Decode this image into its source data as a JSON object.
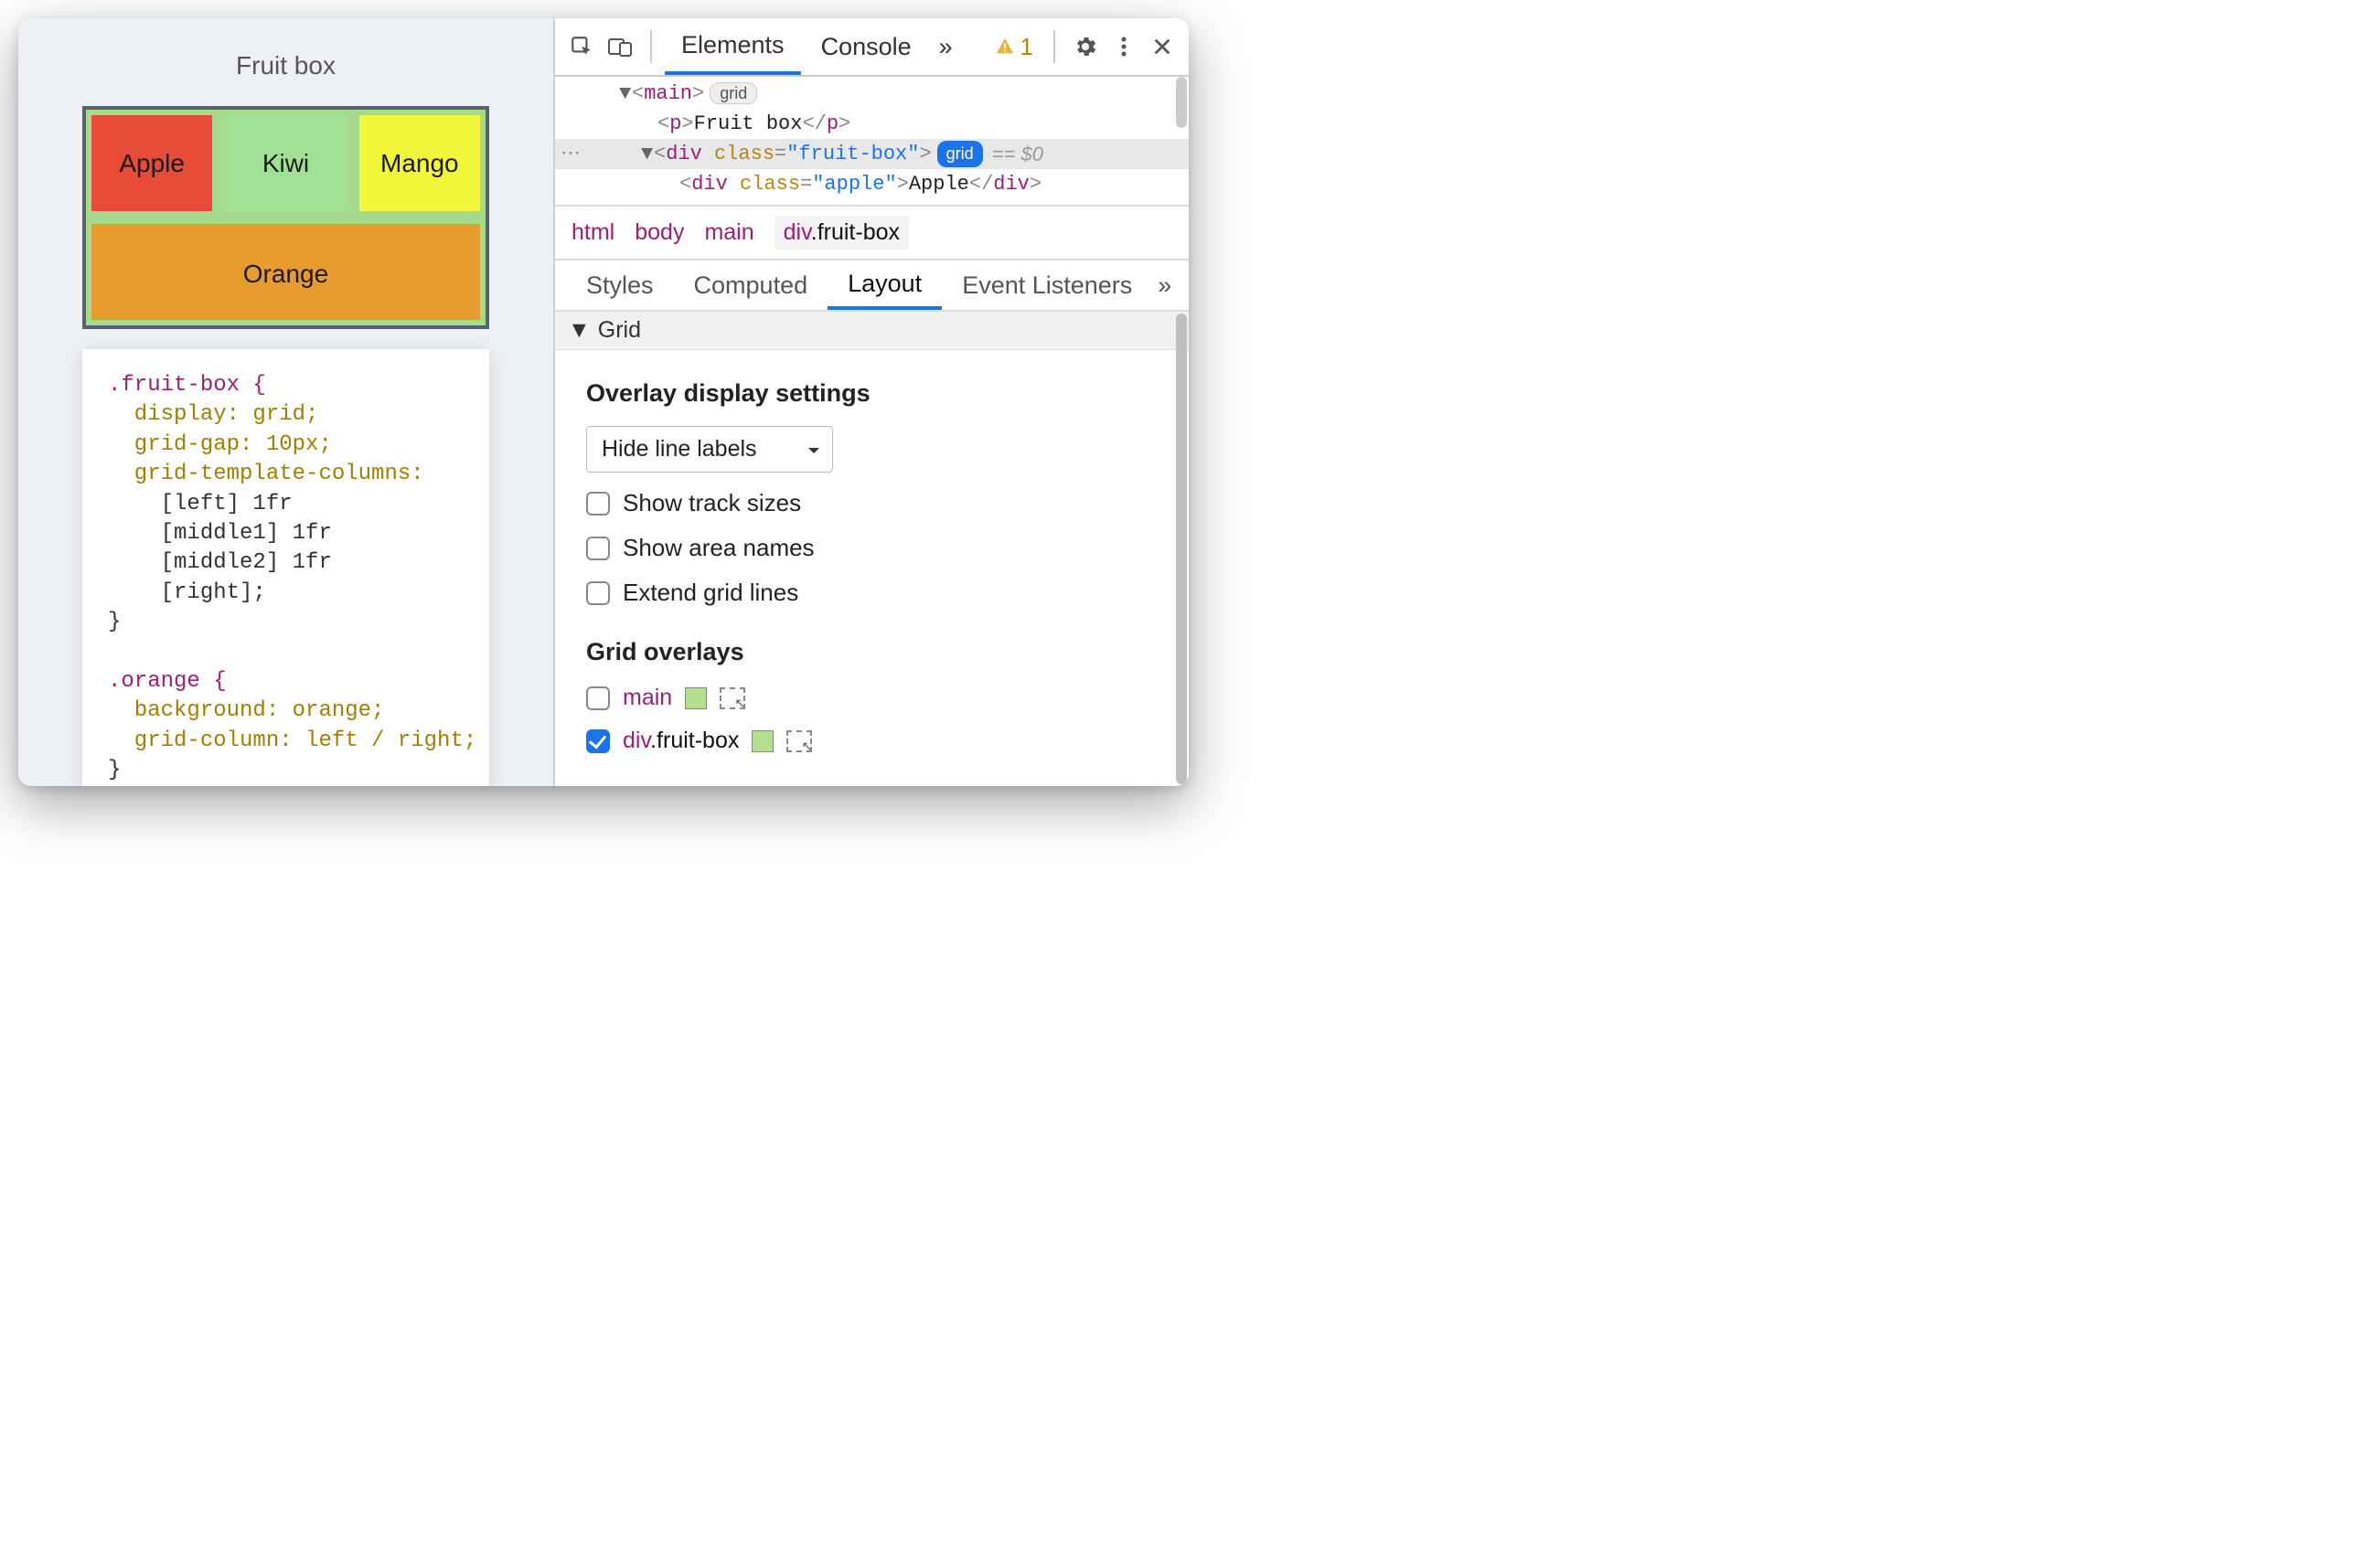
{
  "page": {
    "title": "Fruit box",
    "fruits": {
      "apple": "Apple",
      "kiwi": "Kiwi",
      "mango": "Mango",
      "orange": "Orange"
    },
    "css": {
      "r1": ".fruit-box {",
      "r2": "  display: grid;",
      "r3": "  grid-gap: 10px;",
      "r4": "  grid-template-columns:",
      "r5": "    [left] 1fr",
      "r6": "    [middle1] 1fr",
      "r7": "    [middle2] 1fr",
      "r8": "    [right];",
      "r9": "}",
      "r10": "",
      "r11": ".orange {",
      "r12": "  background: orange;",
      "r13": "  grid-column: left / right;",
      "r14": "}"
    }
  },
  "devtools": {
    "main_tabs": {
      "elements": "Elements",
      "console": "Console",
      "more": "»"
    },
    "warning_count": "1",
    "dom": {
      "main_open": "<main>",
      "grid_pill": "grid",
      "p_line": "<p>Fruit box</p>",
      "fb": {
        "open": "<div ",
        "classattr": "class",
        "eq": "=",
        "classval": "\"fruit-box\"",
        "close": ">",
        "pill": "grid",
        "eq0": "== $0",
        "ellipsis": "⋯"
      },
      "apple": {
        "open": "<div ",
        "classattr": "class",
        "eq": "=",
        "classval": "\"apple\"",
        "mid": ">",
        "text": "Apple",
        "cl": "</div>"
      }
    },
    "crumbs": {
      "html": "html",
      "body": "body",
      "main": "main",
      "fb": "div.fruit-box"
    },
    "subtabs": {
      "styles": "Styles",
      "computed": "Computed",
      "layout": "Layout",
      "listeners": "Event Listeners",
      "more": "»"
    },
    "grid": {
      "header": "Grid",
      "overlay_title": "Overlay display settings",
      "select_value": "Hide line labels",
      "opt1": "Show track sizes",
      "opt2": "Show area names",
      "opt3": "Extend grid lines",
      "overlays_title": "Grid overlays",
      "ov_main": "main",
      "ov_fb_div": "div",
      "ov_fb_rest": ".fruit-box"
    }
  }
}
